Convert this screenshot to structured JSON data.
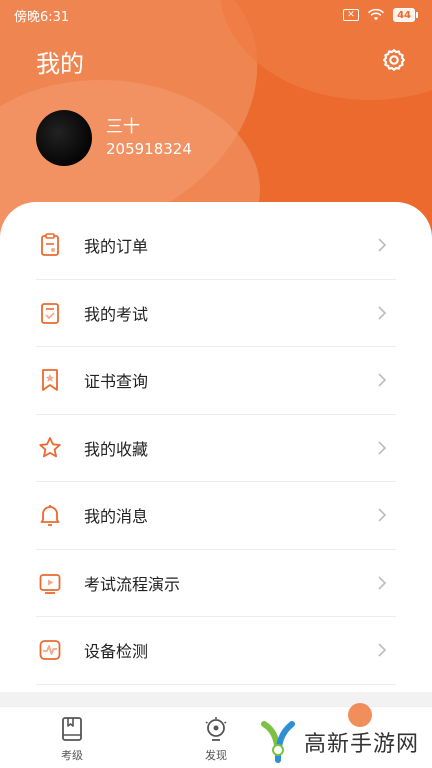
{
  "status_bar": {
    "time": "傍晚6:31",
    "battery": "44"
  },
  "header": {
    "title": "我的"
  },
  "user": {
    "name": "三十",
    "id": "205918324"
  },
  "menu": {
    "items": [
      {
        "label": "我的订单",
        "icon": "clipboard-icon"
      },
      {
        "label": "我的考试",
        "icon": "exam-paper-icon"
      },
      {
        "label": "证书查询",
        "icon": "certificate-icon"
      },
      {
        "label": "我的收藏",
        "icon": "star-icon"
      },
      {
        "label": "我的消息",
        "icon": "bell-icon"
      },
      {
        "label": "考试流程演示",
        "icon": "video-play-icon"
      },
      {
        "label": "设备检测",
        "icon": "device-check-icon"
      }
    ]
  },
  "tabbar": {
    "tabs": [
      {
        "label": "考级",
        "icon": "book-icon"
      },
      {
        "label": "发现",
        "icon": "bulb-icon"
      }
    ]
  },
  "watermark": {
    "text": "高新手游网"
  },
  "colors": {
    "accent": "#ec6a2e",
    "header_light": "#f39a6c"
  }
}
